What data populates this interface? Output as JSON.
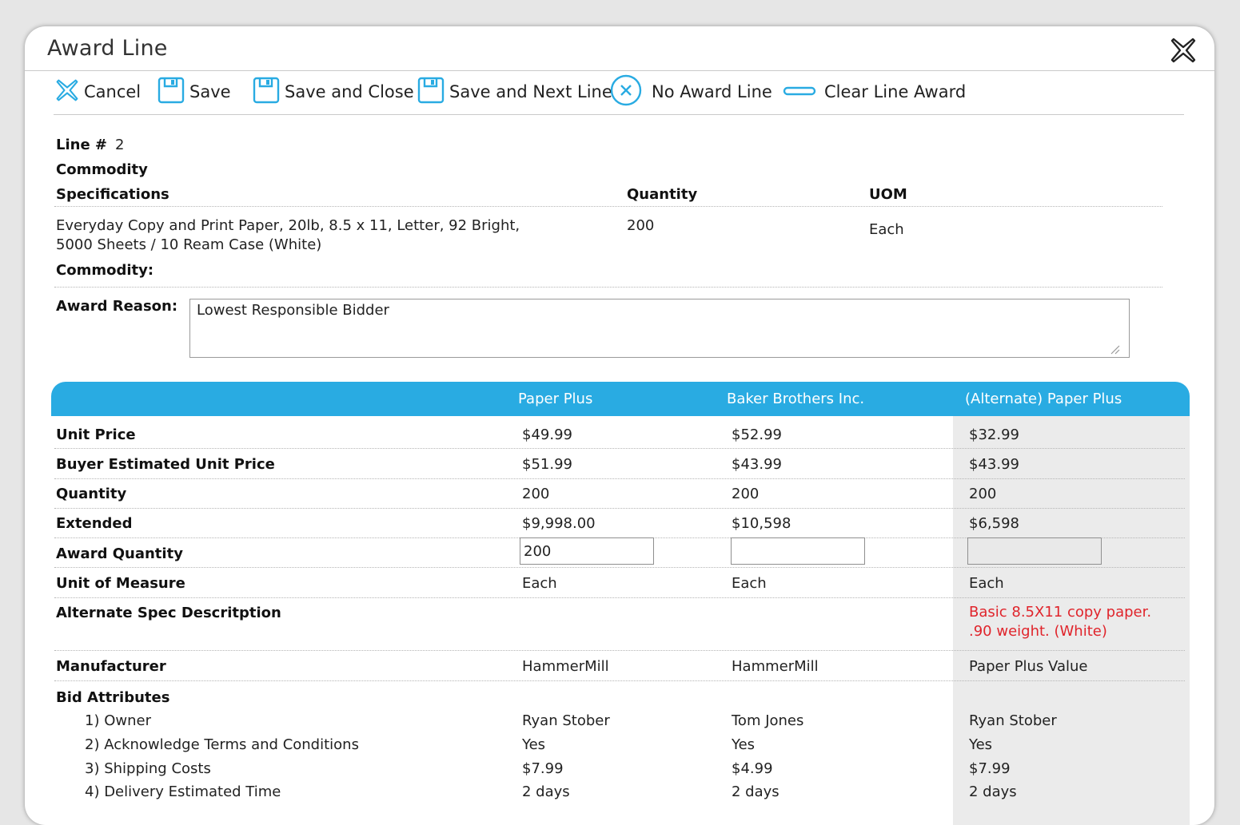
{
  "dialog": {
    "title": "Award Line"
  },
  "toolbar": {
    "cancel": "Cancel",
    "save": "Save",
    "save_close": "Save and Close",
    "save_next": "Save and Next Line",
    "no_award": "No Award Line",
    "clear_award": "Clear Line Award"
  },
  "line": {
    "line_label": "Line #",
    "line_number": "2",
    "commodity_label": "Commodity",
    "spec_label": "Specifications",
    "quantity_label": "Quantity",
    "uom_label": "UOM",
    "spec_line1": "Everyday Copy and Print Paper, 20lb, 8.5 x 11, Letter, 92 Bright,",
    "spec_line2": "5000 Sheets / 10 Ream Case (White)",
    "quantity": "200",
    "uom": "Each",
    "commodity2_label": "Commodity:"
  },
  "award": {
    "reason_label": "Award Reason:",
    "reason_value": "Lowest Responsible Bidder"
  },
  "table": {
    "columns": [
      "Paper Plus",
      "Baker Brothers Inc.",
      "(Alternate) Paper Plus"
    ],
    "rows": {
      "unit_price": {
        "label": "Unit Price",
        "values": [
          "$49.99",
          "$52.99",
          "$32.99"
        ]
      },
      "buyer_est": {
        "label": "Buyer Estimated Unit Price",
        "values": [
          "$51.99",
          "$43.99",
          "$43.99"
        ]
      },
      "quantity": {
        "label": "Quantity",
        "values": [
          "200",
          "200",
          "200"
        ]
      },
      "extended": {
        "label": "Extended",
        "values": [
          "$9,998.00",
          "$10,598",
          "$6,598"
        ]
      },
      "award_qty": {
        "label": "Award Quantity",
        "values": [
          "200",
          "",
          ""
        ]
      },
      "uom": {
        "label": "Unit of Measure",
        "values": [
          "Each",
          "Each",
          "Each"
        ]
      },
      "alt_spec": {
        "label": "Alternate Spec Descritption",
        "values": [
          "",
          "",
          "Basic 8.5X11 copy paper. .90 weight. (White)"
        ]
      },
      "manufacturer": {
        "label": "Manufacturer",
        "values": [
          "HammerMill",
          "HammerMill",
          "Paper Plus Value"
        ]
      },
      "bid_attributes": {
        "label": "Bid Attributes"
      },
      "owner": {
        "label": "1) Owner",
        "values": [
          "Ryan Stober",
          "Tom Jones",
          "Ryan Stober"
        ]
      },
      "terms": {
        "label": "2) Acknowledge Terms and Conditions",
        "values": [
          "Yes",
          "Yes",
          "Yes"
        ]
      },
      "shipping": {
        "label": "3) Shipping Costs",
        "values": [
          "$7.99",
          "$4.99",
          "$7.99"
        ]
      },
      "delivery": {
        "label": "4) Delivery Estimated Time",
        "values": [
          "2 days",
          "2 days",
          "2 days"
        ]
      }
    }
  },
  "colors": {
    "accent": "#29abe2",
    "alt_text": "#e0242b",
    "alt_shade": "#ebebeb"
  }
}
